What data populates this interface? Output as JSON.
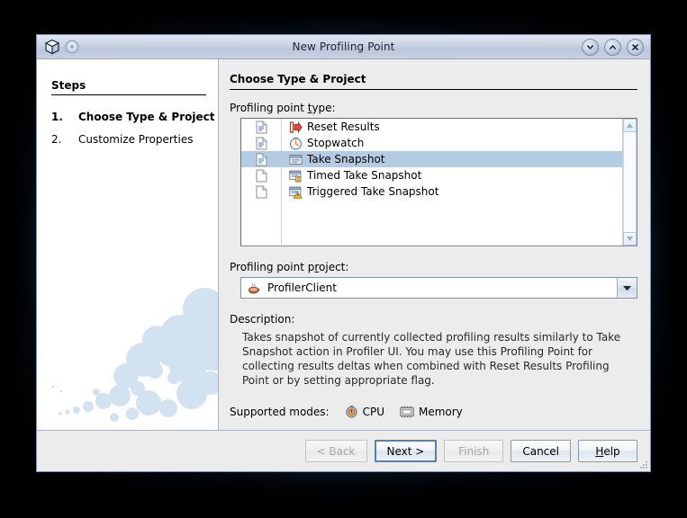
{
  "window": {
    "title": "New Profiling Point",
    "icons": {
      "app": "cube-icon",
      "secondary": "orb-icon",
      "minimize": "chevron-down-icon",
      "maximize": "chevron-up-icon",
      "close": "close-x-icon"
    }
  },
  "steps": {
    "heading": "Steps",
    "items": [
      {
        "num": "1.",
        "label": "Choose Type & Project",
        "active": true
      },
      {
        "num": "2.",
        "label": "Customize Properties",
        "active": false
      }
    ]
  },
  "content": {
    "title": "Choose Type & Project",
    "type_label_pre": "Profiling point ",
    "type_label_mn": "t",
    "type_label_post": "ype:",
    "project_label_pre": "Profiling point p",
    "project_label_mn": "r",
    "project_label_post": "oject:",
    "description_label": "Description:",
    "description_text": "Takes snapshot of currently collected profiling results similarly to Take Snapshot action in Profiler UI. You may use this Profiling Point for collecting results deltas when combined with Reset Results Profiling Point or by setting appropriate flag.",
    "modes_label": "Supported modes:",
    "modes": [
      {
        "label": "CPU",
        "icon": "cpu-stopwatch-icon"
      },
      {
        "label": "Memory",
        "icon": "memory-icon"
      }
    ]
  },
  "profiling_point_types": [
    {
      "label": "Reset Results",
      "icon": "reset-results-icon",
      "doc_icon": "document-lines-icon",
      "selected": false
    },
    {
      "label": "Stopwatch",
      "icon": "stopwatch-icon",
      "doc_icon": "document-lines-icon",
      "selected": false
    },
    {
      "label": "Take Snapshot",
      "icon": "take-snapshot-icon",
      "doc_icon": "document-lines-icon",
      "selected": true
    },
    {
      "label": "Timed Take Snapshot",
      "icon": "timed-take-snapshot-icon",
      "doc_icon": "document-blank-icon",
      "selected": false
    },
    {
      "label": "Triggered Take Snapshot",
      "icon": "triggered-take-snapshot-icon",
      "doc_icon": "document-blank-icon",
      "selected": false
    }
  ],
  "project_combo": {
    "value": "ProfilerClient",
    "icon": "java-coffee-icon"
  },
  "buttons": [
    {
      "label": "< Back",
      "state": "disabled"
    },
    {
      "label": "Next >",
      "state": "default"
    },
    {
      "label": "Finish",
      "state": "disabled"
    },
    {
      "label": "Cancel",
      "state": "normal"
    },
    {
      "label": "Help",
      "state": "normal",
      "mnemonic": "H"
    }
  ],
  "colors": {
    "selection": "#b4cbe4",
    "titlebar": "#c7d0e2",
    "panel": "#ececec",
    "glow": "#5aafe1"
  }
}
